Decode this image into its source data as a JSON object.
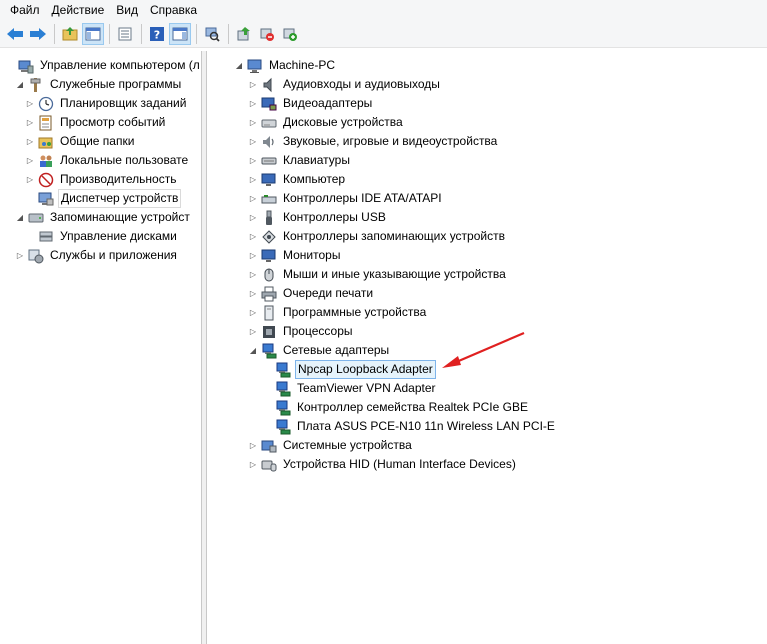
{
  "menu": [
    "Файл",
    "Действие",
    "Вид",
    "Справка"
  ],
  "toolbar": {
    "buttons": [
      "back-icon",
      "forward-icon",
      "up-folder-icon",
      "show-hide-tree-icon",
      "properties-icon",
      "help-icon",
      "action-pane-icon",
      "scan-hardware-icon",
      "update-driver-icon",
      "disable-device-icon",
      "uninstall-device-icon"
    ]
  },
  "left_tree": [
    {
      "label": "Управление компьютером (л",
      "level": 0,
      "expander": "",
      "icon": "computer-management-icon"
    },
    {
      "label": "Служебные программы",
      "level": 1,
      "expander": "expanded",
      "icon": "tools-icon"
    },
    {
      "label": "Планировщик заданий",
      "level": 2,
      "expander": "collapsed",
      "icon": "clock-icon"
    },
    {
      "label": "Просмотр событий",
      "level": 2,
      "expander": "collapsed",
      "icon": "event-viewer-icon"
    },
    {
      "label": "Общие папки",
      "level": 2,
      "expander": "collapsed",
      "icon": "shared-folder-icon"
    },
    {
      "label": "Локальные пользовате",
      "level": 2,
      "expander": "collapsed",
      "icon": "users-icon"
    },
    {
      "label": "Производительность",
      "level": 2,
      "expander": "collapsed",
      "icon": "performance-icon"
    },
    {
      "label": "Диспетчер устройств",
      "level": 2,
      "expander": "",
      "icon": "device-manager-icon",
      "selected": true
    },
    {
      "label": "Запоминающие устройст",
      "level": 1,
      "expander": "expanded",
      "icon": "storage-icon"
    },
    {
      "label": "Управление дисками",
      "level": 2,
      "expander": "",
      "icon": "disk-management-icon"
    },
    {
      "label": "Службы и приложения",
      "level": 1,
      "expander": "collapsed",
      "icon": "services-icon"
    }
  ],
  "right_tree": [
    {
      "label": "Machine-PC",
      "level": 0,
      "expander": "expanded",
      "icon": "computer-icon"
    },
    {
      "label": "Аудиовходы и аудиовыходы",
      "level": 1,
      "expander": "collapsed",
      "icon": "audio-icon"
    },
    {
      "label": "Видеоадаптеры",
      "level": 1,
      "expander": "collapsed",
      "icon": "display-adapter-icon"
    },
    {
      "label": "Дисковые устройства",
      "level": 1,
      "expander": "collapsed",
      "icon": "disk-drive-icon"
    },
    {
      "label": "Звуковые, игровые и видеоустройства",
      "level": 1,
      "expander": "collapsed",
      "icon": "speaker-icon"
    },
    {
      "label": "Клавиатуры",
      "level": 1,
      "expander": "collapsed",
      "icon": "keyboard-icon"
    },
    {
      "label": "Компьютер",
      "level": 1,
      "expander": "collapsed",
      "icon": "monitor-icon"
    },
    {
      "label": "Контроллеры IDE ATA/ATAPI",
      "level": 1,
      "expander": "collapsed",
      "icon": "ide-controller-icon"
    },
    {
      "label": "Контроллеры USB",
      "level": 1,
      "expander": "collapsed",
      "icon": "usb-icon"
    },
    {
      "label": "Контроллеры запоминающих устройств",
      "level": 1,
      "expander": "collapsed",
      "icon": "storage-controller-icon"
    },
    {
      "label": "Мониторы",
      "level": 1,
      "expander": "collapsed",
      "icon": "monitor-icon"
    },
    {
      "label": "Мыши и иные указывающие устройства",
      "level": 1,
      "expander": "collapsed",
      "icon": "mouse-icon"
    },
    {
      "label": "Очереди печати",
      "level": 1,
      "expander": "collapsed",
      "icon": "printer-icon"
    },
    {
      "label": "Программные устройства",
      "level": 1,
      "expander": "collapsed",
      "icon": "software-device-icon"
    },
    {
      "label": "Процессоры",
      "level": 1,
      "expander": "collapsed",
      "icon": "processor-icon"
    },
    {
      "label": "Сетевые адаптеры",
      "level": 1,
      "expander": "expanded",
      "icon": "network-adapter-icon"
    },
    {
      "label": "Npcap Loopback Adapter",
      "level": 2,
      "expander": "",
      "icon": "network-adapter-icon",
      "highlighted": true
    },
    {
      "label": "TeamViewer VPN Adapter",
      "level": 2,
      "expander": "",
      "icon": "network-adapter-icon"
    },
    {
      "label": "Контроллер семейства Realtek PCIe GBE",
      "level": 2,
      "expander": "",
      "icon": "network-adapter-icon"
    },
    {
      "label": "Плата ASUS PCE-N10 11n Wireless LAN PCI-E",
      "level": 2,
      "expander": "",
      "icon": "network-adapter-icon"
    },
    {
      "label": "Системные устройства",
      "level": 1,
      "expander": "collapsed",
      "icon": "system-device-icon"
    },
    {
      "label": "Устройства HID (Human Interface Devices)",
      "level": 1,
      "expander": "collapsed",
      "icon": "hid-icon"
    }
  ],
  "colors": {
    "arrow": "#e02020",
    "selection_border": "#7eb4ea",
    "selection_bg": "#e5f3fb"
  }
}
